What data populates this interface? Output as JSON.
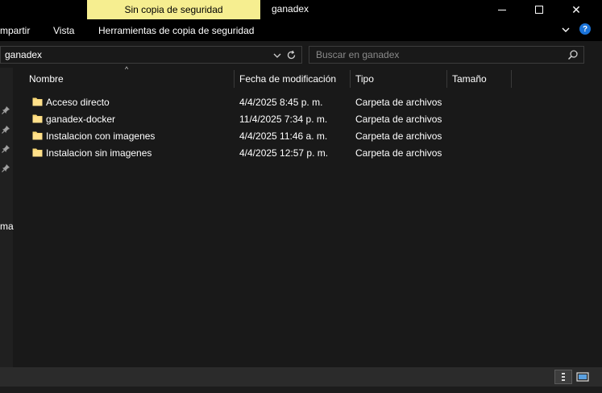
{
  "titlebar": {
    "tool_tab_label": "Sin copia de seguridad",
    "window_title": "ganadex",
    "close_symbol": "✕"
  },
  "ribbon": {
    "tabs": [
      "mpartir",
      "Vista",
      "Herramientas de copia de seguridad"
    ],
    "help_symbol": "?"
  },
  "address": {
    "path": "ganadex",
    "search_placeholder": "Buscar en ganadex"
  },
  "nav": {
    "partial_label": "ma"
  },
  "columns": {
    "name": "Nombre",
    "date": "Fecha de modificación",
    "type": "Tipo",
    "size": "Tamaño"
  },
  "files": [
    {
      "name": "Acceso directo",
      "date": "4/4/2025 8:45 p. m.",
      "type": "Carpeta de archivos"
    },
    {
      "name": "ganadex-docker",
      "date": "11/4/2025 7:34 p. m.",
      "type": "Carpeta de archivos"
    },
    {
      "name": "Instalacion con imagenes",
      "date": "4/4/2025 11:46 a. m.",
      "type": "Carpeta de archivos"
    },
    {
      "name": "Instalacion sin imagenes",
      "date": "4/4/2025 12:57 p. m.",
      "type": "Carpeta de archivos"
    }
  ],
  "colors": {
    "tool_tab_bg": "#f6ee90",
    "window_bg": "#191919",
    "folder_yellow": "#f8d775"
  },
  "icons": [
    "minimize-icon",
    "maximize-icon",
    "close-icon",
    "chevron-down-icon",
    "help-icon",
    "refresh-icon",
    "search-icon",
    "pin-icon",
    "folder-icon",
    "details-view-icon",
    "large-icons-view-icon"
  ]
}
